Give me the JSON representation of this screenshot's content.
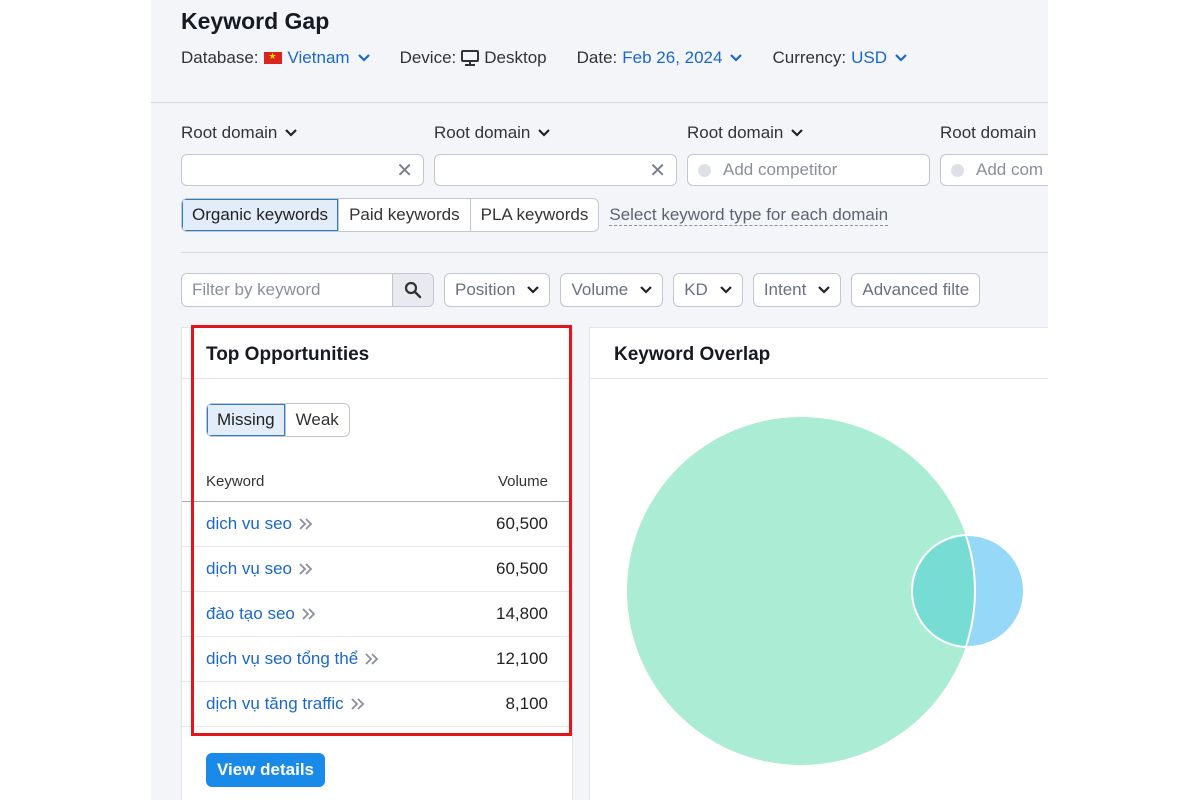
{
  "header": {
    "title": "Keyword Gap",
    "database_label": "Database:",
    "database_value": "Vietnam",
    "device_label": "Device:",
    "device_value": "Desktop",
    "date_label": "Date:",
    "date_value": "Feb 26, 2024",
    "currency_label": "Currency:",
    "currency_value": "USD"
  },
  "domains": [
    {
      "label": "Root domain",
      "value": "",
      "placeholder": ""
    },
    {
      "label": "Root domain",
      "value": "",
      "placeholder": ""
    },
    {
      "label": "Root domain",
      "value": "",
      "placeholder": "Add competitor"
    },
    {
      "label": "Root domain",
      "value": "",
      "placeholder": "Add com"
    }
  ],
  "keyword_types": {
    "options": [
      "Organic keywords",
      "Paid keywords",
      "PLA keywords"
    ],
    "selected": "Organic keywords",
    "per_domain_link": "Select keyword type for each domain"
  },
  "filters": {
    "search_placeholder": "Filter by keyword",
    "buttons": [
      "Position",
      "Volume",
      "KD",
      "Intent",
      "Advanced filte"
    ]
  },
  "top_opportunities": {
    "title": "Top Opportunities",
    "tabs": [
      "Missing",
      "Weak"
    ],
    "selected_tab": "Missing",
    "col_keyword": "Keyword",
    "col_volume": "Volume",
    "rows": [
      {
        "keyword": "dich vu seo",
        "volume": "60,500"
      },
      {
        "keyword": "dịch vụ seo",
        "volume": "60,500"
      },
      {
        "keyword": "đào tạo seo",
        "volume": "14,800"
      },
      {
        "keyword": "dịch vụ seo tổng thể",
        "volume": "12,100"
      },
      {
        "keyword": "dịch vụ tăng traffic",
        "volume": "8,100"
      }
    ],
    "view_details": "View details"
  },
  "keyword_overlap": {
    "title": "Keyword Overlap",
    "colors": {
      "domain1": "#abedd4",
      "domain2": "#95d8f8",
      "overlap": "#76dcd4"
    }
  },
  "highlight_color": "#e4141b"
}
